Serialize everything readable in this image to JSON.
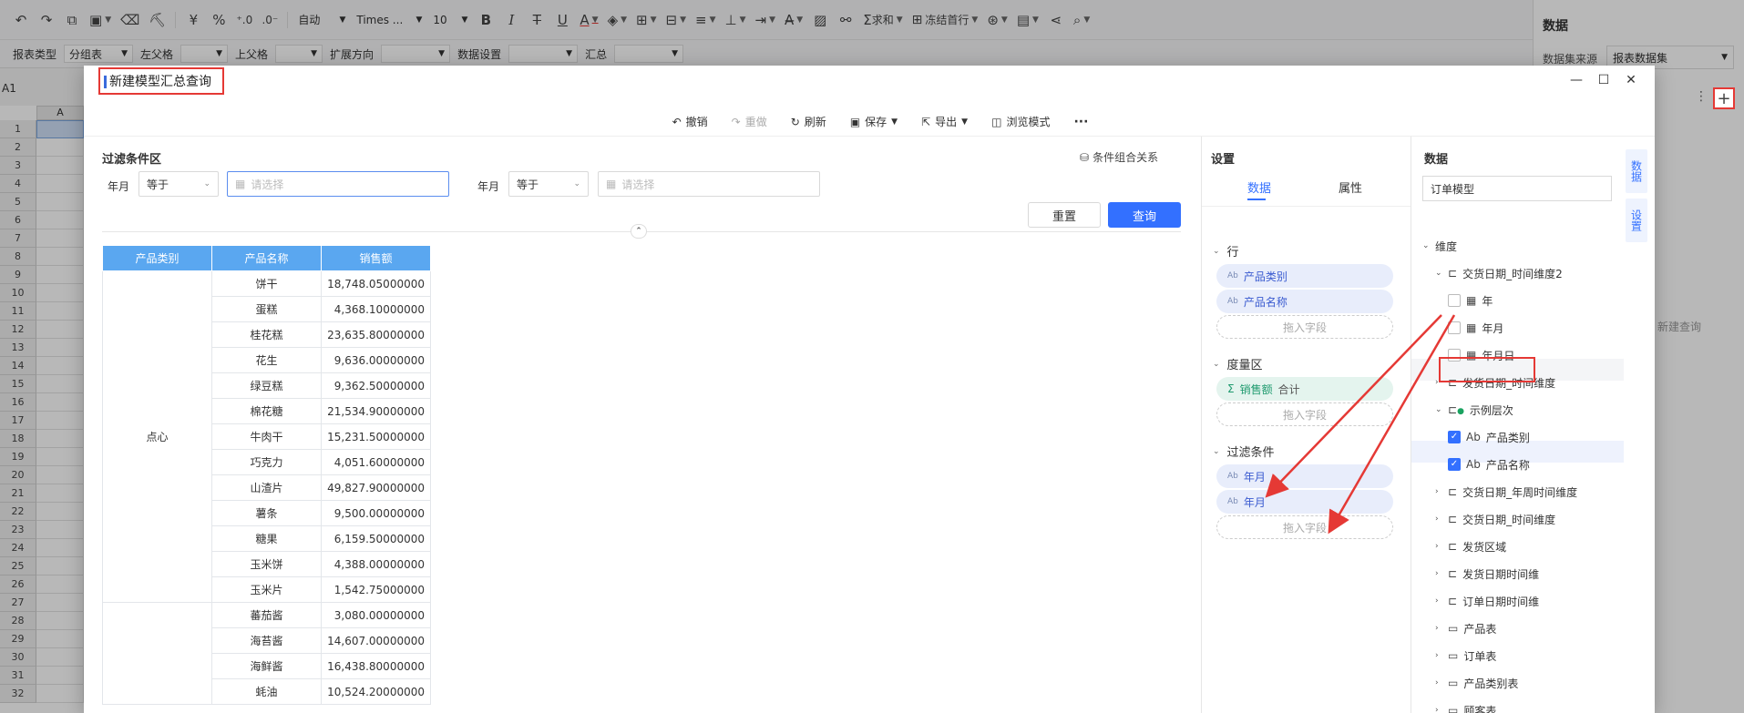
{
  "app_toolbar": {
    "font_auto": "自动",
    "font_name": "Times ...",
    "font_size": "10",
    "sum_label": "求和",
    "freeze_label": "冻结首行",
    "currency_symbol": "¥",
    "percent_symbol": "%"
  },
  "report_bar": {
    "report_type_label": "报表类型",
    "report_type_value": "分组表",
    "left_parent_label": "左父格",
    "top_parent_label": "上父格",
    "expand_label": "扩展方向",
    "data_settings_label": "数据设置",
    "summary_label": "汇总"
  },
  "grid": {
    "name_box": "A1",
    "column": "A",
    "rows": [
      "1",
      "2",
      "3",
      "4",
      "5",
      "6",
      "7",
      "8",
      "9",
      "10",
      "11",
      "12",
      "13",
      "14",
      "15",
      "16",
      "17",
      "18",
      "19",
      "20",
      "21",
      "22",
      "23",
      "24",
      "25",
      "26",
      "27",
      "28",
      "29",
      "30",
      "31",
      "32"
    ]
  },
  "bg_panel": {
    "title": "数据",
    "source_label": "数据集来源",
    "source_value": "报表数据集",
    "new_query": "新建查询",
    "plus": "+"
  },
  "dialog": {
    "title": "新建模型汇总查询",
    "actions": [
      {
        "label": "撤销",
        "icon": "undo-icon",
        "disabled": false
      },
      {
        "label": "重做",
        "icon": "redo-icon",
        "disabled": true
      },
      {
        "label": "刷新",
        "icon": "refresh-icon",
        "disabled": false
      },
      {
        "label": "保存",
        "icon": "save-icon",
        "disabled": false
      },
      {
        "label": "导出",
        "icon": "export-icon",
        "disabled": false
      },
      {
        "label": "浏览模式",
        "icon": "preview-icon",
        "disabled": false
      }
    ],
    "more": "···"
  },
  "filter": {
    "title": "过滤条件区",
    "combine": "条件组合关系",
    "f1_label": "年月",
    "f1_op": "等于",
    "f1_placeholder": "请选择",
    "f2_label": "年月",
    "f2_op": "等于",
    "f2_placeholder": "请选择",
    "reset": "重置",
    "query": "查询"
  },
  "table": {
    "headers": [
      "产品类别",
      "产品名称",
      "销售额"
    ],
    "group1": "点心",
    "rows": [
      [
        "饼干",
        "18,748.05000000"
      ],
      [
        "蛋糕",
        "4,368.10000000"
      ],
      [
        "桂花糕",
        "23,635.80000000"
      ],
      [
        "花生",
        "9,636.00000000"
      ],
      [
        "绿豆糕",
        "9,362.50000000"
      ],
      [
        "棉花糖",
        "21,534.90000000"
      ],
      [
        "牛肉干",
        "15,231.50000000"
      ],
      [
        "巧克力",
        "4,051.60000000"
      ],
      [
        "山渣片",
        "49,827.90000000"
      ],
      [
        "薯条",
        "9,500.00000000"
      ],
      [
        "糖果",
        "6,159.50000000"
      ],
      [
        "玉米饼",
        "4,388.00000000"
      ],
      [
        "玉米片",
        "1,542.75000000"
      ],
      [
        "蕃茄酱",
        "3,080.00000000"
      ],
      [
        "海苔酱",
        "14,607.00000000"
      ],
      [
        "海鲜酱",
        "16,438.80000000"
      ],
      [
        "蚝油",
        "10,524.20000000"
      ]
    ]
  },
  "settings": {
    "title": "设置",
    "tab_data": "数据",
    "tab_props": "属性",
    "row_section": "行",
    "row_fields": [
      "产品类别",
      "产品名称"
    ],
    "drop_hint": "拖入字段",
    "measure_section": "度量区",
    "measure_field": "销售额",
    "measure_agg": "合计",
    "filter_section": "过滤条件",
    "filter_fields": [
      "年月",
      "年月"
    ]
  },
  "data_panel": {
    "title": "数据",
    "model": "订单模型",
    "tree": [
      {
        "label": "维度",
        "level": 0,
        "type": "root"
      },
      {
        "label": "交货日期_时间维度2",
        "level": 1,
        "type": "hier",
        "open": true
      },
      {
        "label": "年",
        "level": 2,
        "type": "date",
        "checked": false
      },
      {
        "label": "年月",
        "level": 2,
        "type": "date",
        "checked": false
      },
      {
        "label": "年月日",
        "level": 2,
        "type": "date",
        "checked": false
      },
      {
        "label": "发货日期_时间维度",
        "level": 1,
        "type": "hier"
      },
      {
        "label": "示例层次",
        "level": 1,
        "type": "hier-ok",
        "open": true
      },
      {
        "label": "产品类别",
        "level": 2,
        "type": "text",
        "checked": true
      },
      {
        "label": "产品名称",
        "level": 2,
        "type": "text",
        "checked": true
      },
      {
        "label": "交货日期_年周时间维度",
        "level": 1,
        "type": "hier"
      },
      {
        "label": "交货日期_时间维度",
        "level": 1,
        "type": "hier"
      },
      {
        "label": "发货区域",
        "level": 1,
        "type": "hier"
      },
      {
        "label": "发货日期时间维",
        "level": 1,
        "type": "hier"
      },
      {
        "label": "订单日期时间维",
        "level": 1,
        "type": "hier"
      },
      {
        "label": "产品表",
        "level": 1,
        "type": "folder"
      },
      {
        "label": "订单表",
        "level": 1,
        "type": "folder"
      },
      {
        "label": "产品类别表",
        "level": 1,
        "type": "folder"
      },
      {
        "label": "顾客表",
        "level": 1,
        "type": "folder"
      }
    ],
    "vtab_data": "数据",
    "vtab_settings": "设置"
  },
  "colors": {
    "accent": "#3370ff",
    "header_blue": "#5aa7f0",
    "annotation_red": "#e53935"
  }
}
